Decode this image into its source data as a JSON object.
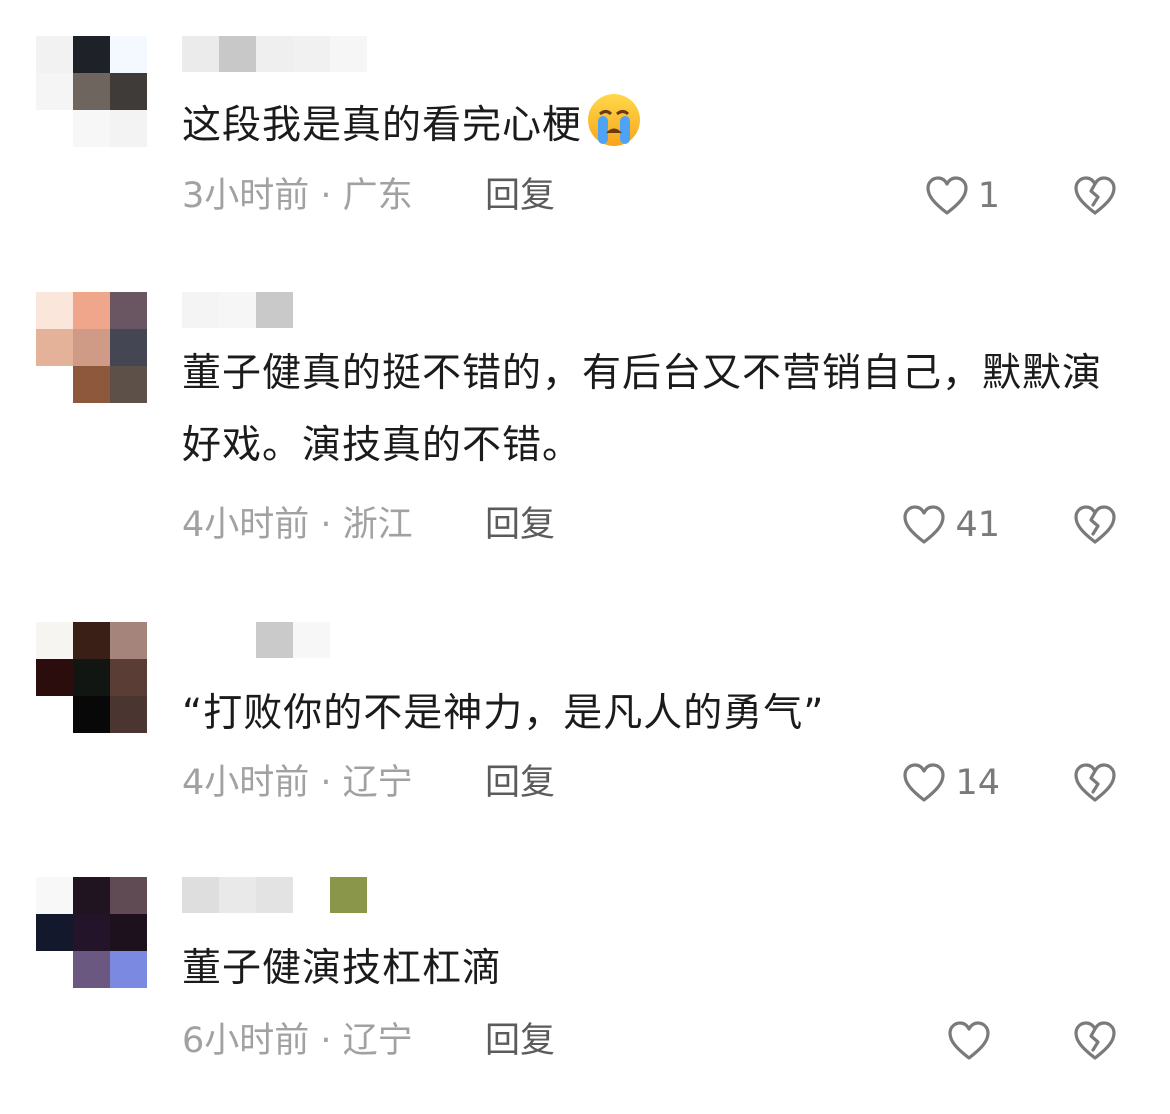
{
  "comments": [
    {
      "text": "这段我是真的看完心梗",
      "emoji": "crying-face",
      "time": "3小时前",
      "location": "广东",
      "reply": "回复",
      "likes": "1"
    },
    {
      "text": "董子健真的挺不错的，有后台又不营销自己，默默演好戏。演技真的不错。",
      "time": "4小时前",
      "location": "浙江",
      "reply": "回复",
      "likes": "41"
    },
    {
      "text": "“打败你的不是神力，是凡人的勇气”",
      "time": "4小时前",
      "location": "辽宁",
      "reply": "回复",
      "likes": "14"
    },
    {
      "text": "董子健演技杠杠滴",
      "time": "6小时前",
      "location": "辽宁",
      "reply": "回复",
      "likes": ""
    }
  ],
  "meta_separator": " · ",
  "icons": {
    "like": "heart-outline-icon",
    "dislike": "broken-heart-icon"
  },
  "colors": {
    "text": "#1b1b1b",
    "meta": "#a1a1a1",
    "reply": "#5b5b5b",
    "icon": "#7a7a7a"
  }
}
